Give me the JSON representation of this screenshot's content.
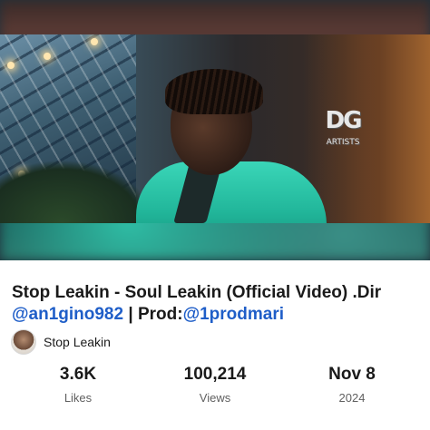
{
  "video": {
    "title_text": "Stop Leakin - Soul Leakin (Official Video) .Dir ",
    "director_handle": "@an1gino982",
    "separator": " | Prod:",
    "producer_handle": "@1prodmari",
    "logo_letters": "DG",
    "logo_subtext": "ARTISTS"
  },
  "channel": {
    "name": "Stop Leakin"
  },
  "stats": [
    {
      "value": "3.6K",
      "label": "Likes"
    },
    {
      "value": "100,214",
      "label": "Views"
    },
    {
      "value": "Nov 8",
      "label": "2024"
    }
  ],
  "colors": {
    "link": "#1f5ec8",
    "text": "#1a1a1a",
    "secondary_text": "#606060",
    "jacket_teal": "#2ac8aa"
  }
}
